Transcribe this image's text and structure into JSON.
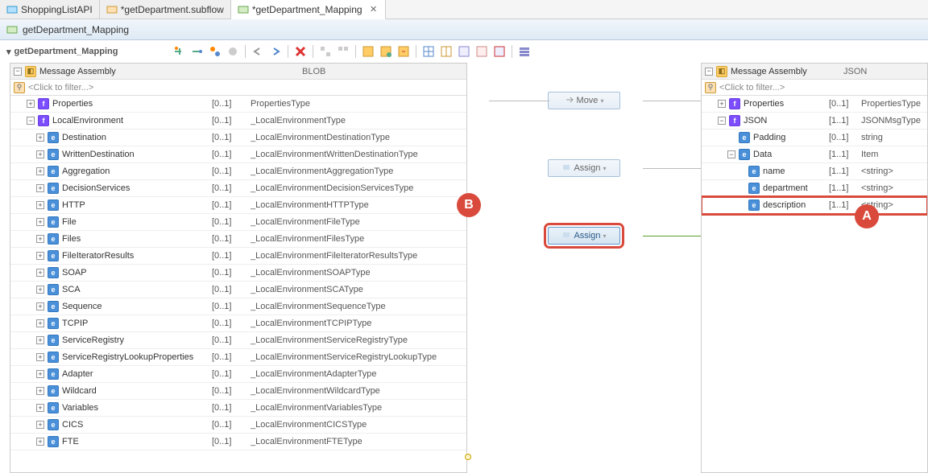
{
  "tabs": [
    {
      "label": "ShoppingListAPI"
    },
    {
      "label": "*getDepartment.subflow"
    },
    {
      "label": "*getDepartment_Mapping"
    }
  ],
  "header": {
    "title": "getDepartment_Mapping"
  },
  "breadcrumb": {
    "label": "getDepartment_Mapping"
  },
  "left_panel": {
    "header_label": "Message Assembly",
    "header_type": "BLOB",
    "filter_placeholder": "<Click to filter...>",
    "rows": [
      {
        "exp": "+",
        "icon": "f",
        "name": "Properties",
        "card": "[0..1]",
        "type": "PropertiesType",
        "indent": 1
      },
      {
        "exp": "-",
        "icon": "f",
        "name": "LocalEnvironment",
        "card": "[0..1]",
        "type": "_LocalEnvironmentType",
        "indent": 1
      },
      {
        "exp": "+",
        "icon": "e",
        "name": "Destination",
        "card": "[0..1]",
        "type": "_LocalEnvironmentDestinationType",
        "indent": 2
      },
      {
        "exp": "+",
        "icon": "e",
        "name": "WrittenDestination",
        "card": "[0..1]",
        "type": "_LocalEnvironmentWrittenDestinationType",
        "indent": 2
      },
      {
        "exp": "+",
        "icon": "e",
        "name": "Aggregation",
        "card": "[0..1]",
        "type": "_LocalEnvironmentAggregationType",
        "indent": 2
      },
      {
        "exp": "+",
        "icon": "e",
        "name": "DecisionServices",
        "card": "[0..1]",
        "type": "_LocalEnvironmentDecisionServicesType",
        "indent": 2
      },
      {
        "exp": "+",
        "icon": "e",
        "name": "HTTP",
        "card": "[0..1]",
        "type": "_LocalEnvironmentHTTPType",
        "indent": 2
      },
      {
        "exp": "+",
        "icon": "e",
        "name": "File",
        "card": "[0..1]",
        "type": "_LocalEnvironmentFileType",
        "indent": 2
      },
      {
        "exp": "+",
        "icon": "e",
        "name": "Files",
        "card": "[0..1]",
        "type": "_LocalEnvironmentFilesType",
        "indent": 2
      },
      {
        "exp": "+",
        "icon": "e",
        "name": "FileIteratorResults",
        "card": "[0..1]",
        "type": "_LocalEnvironmentFileIteratorResultsType",
        "indent": 2
      },
      {
        "exp": "+",
        "icon": "e",
        "name": "SOAP",
        "card": "[0..1]",
        "type": "_LocalEnvironmentSOAPType",
        "indent": 2
      },
      {
        "exp": "+",
        "icon": "e",
        "name": "SCA",
        "card": "[0..1]",
        "type": "_LocalEnvironmentSCAType",
        "indent": 2
      },
      {
        "exp": "+",
        "icon": "e",
        "name": "Sequence",
        "card": "[0..1]",
        "type": "_LocalEnvironmentSequenceType",
        "indent": 2
      },
      {
        "exp": "+",
        "icon": "e",
        "name": "TCPIP",
        "card": "[0..1]",
        "type": "_LocalEnvironmentTCPIPType",
        "indent": 2
      },
      {
        "exp": "+",
        "icon": "e",
        "name": "ServiceRegistry",
        "card": "[0..1]",
        "type": "_LocalEnvironmentServiceRegistryType",
        "indent": 2
      },
      {
        "exp": "+",
        "icon": "e",
        "name": "ServiceRegistryLookupProperties",
        "card": "[0..1]",
        "type": "_LocalEnvironmentServiceRegistryLookupType",
        "indent": 2
      },
      {
        "exp": "+",
        "icon": "e",
        "name": "Adapter",
        "card": "[0..1]",
        "type": "_LocalEnvironmentAdapterType",
        "indent": 2
      },
      {
        "exp": "+",
        "icon": "e",
        "name": "Wildcard",
        "card": "[0..1]",
        "type": "_LocalEnvironmentWildcardType",
        "indent": 2
      },
      {
        "exp": "+",
        "icon": "e",
        "name": "Variables",
        "card": "[0..1]",
        "type": "_LocalEnvironmentVariablesType",
        "indent": 2
      },
      {
        "exp": "+",
        "icon": "e",
        "name": "CICS",
        "card": "[0..1]",
        "type": "_LocalEnvironmentCICSType",
        "indent": 2
      },
      {
        "exp": "+",
        "icon": "e",
        "name": "FTE",
        "card": "[0..1]",
        "type": "_LocalEnvironmentFTEType",
        "indent": 2
      }
    ]
  },
  "right_panel": {
    "header_label": "Message Assembly",
    "header_type": "JSON",
    "filter_placeholder": "<Click to filter...>",
    "rows": [
      {
        "exp": "+",
        "icon": "f",
        "name": "Properties",
        "card": "[0..1]",
        "type": "PropertiesType",
        "indent": 1
      },
      {
        "exp": "-",
        "icon": "f",
        "name": "JSON",
        "card": "[1..1]",
        "type": "JSONMsgType",
        "indent": 1
      },
      {
        "exp": "",
        "icon": "e",
        "name": "Padding",
        "card": "[0..1]",
        "type": "string",
        "indent": 2
      },
      {
        "exp": "-",
        "icon": "e",
        "name": "Data",
        "card": "[1..1]",
        "type": "Item",
        "indent": 2
      },
      {
        "exp": "",
        "icon": "e",
        "name": "name",
        "card": "[1..1]",
        "type": "<string>",
        "indent": 3
      },
      {
        "exp": "",
        "icon": "e",
        "name": "department",
        "card": "[1..1]",
        "type": "<string>",
        "indent": 3
      },
      {
        "exp": "",
        "icon": "e",
        "name": "description",
        "card": "[1..1]",
        "type": "<string>",
        "indent": 3,
        "highlighted": true
      }
    ]
  },
  "transforms": {
    "move": "Move",
    "assign1": "Assign",
    "assign2": "Assign"
  },
  "callouts": {
    "a": "A",
    "b": "B"
  }
}
